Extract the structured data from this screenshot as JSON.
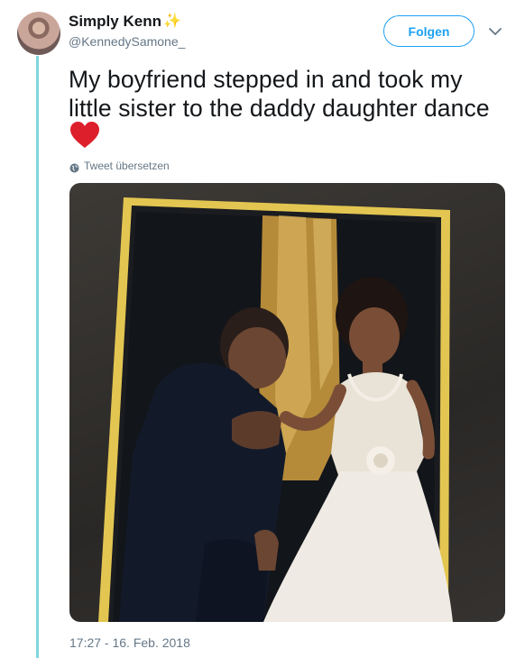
{
  "tweet": {
    "display_name": "Simply Kenn",
    "handle": "@KennedySamone_",
    "text": "My boyfriend stepped in and took my little sister to the daddy daughter dance",
    "translate_label": "Tweet übersetzen",
    "timestamp": "17:27 - 16. Feb. 2018"
  },
  "header": {
    "follow_label": "Folgen"
  },
  "icons": {
    "name_emoji": "sparkles-icon",
    "text_emoji": "heart-icon",
    "translate": "globe-icon",
    "more": "chevron-down-icon"
  },
  "colors": {
    "accent": "#1da1f2",
    "thread_line": "#7fd6df",
    "secondary_text": "#657786",
    "heart": "#e0245e"
  }
}
